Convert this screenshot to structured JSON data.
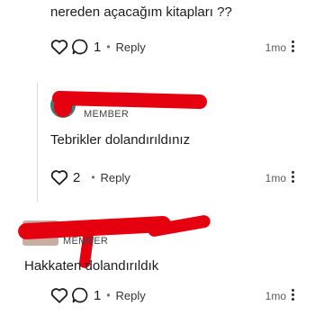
{
  "comments": [
    {
      "text": "nereden açacağım kitapları ??",
      "upvote_count": "1",
      "reply_label": "Reply",
      "age": "1mo"
    },
    {
      "role_label": "MEMBER",
      "text": "Tebrikler dolandırıldınız",
      "upvote_count": "2",
      "reply_label": "Reply",
      "age": "1mo"
    },
    {
      "role_label": "MEMBER",
      "text": "Hakkaten dolandırıldık",
      "upvote_count": "1",
      "reply_label": "Reply",
      "age": "1mo"
    }
  ],
  "colors": {
    "redaction": "#e5000f",
    "text": "#1c1c1c",
    "muted": "#5a5a5a"
  }
}
